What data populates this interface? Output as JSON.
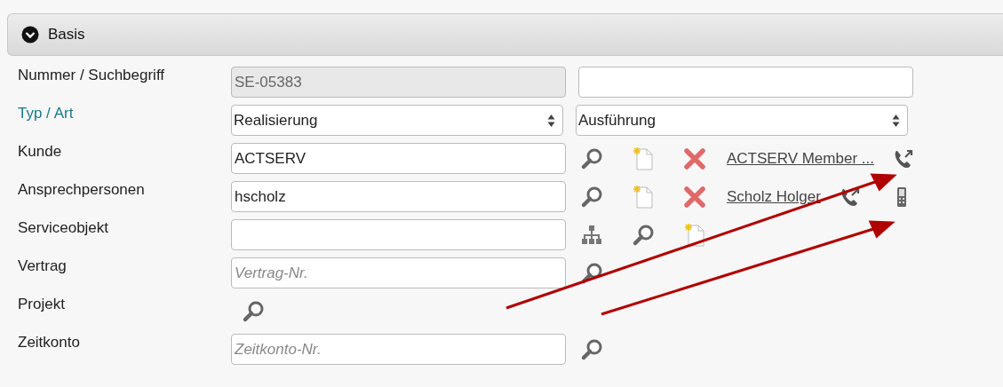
{
  "panel": {
    "title": "Basis",
    "expanded": true
  },
  "rows": [
    {
      "label": "Nummer / Suchbegriff",
      "label_link": false,
      "controls": [
        {
          "kind": "text",
          "value": "SE-05383",
          "disabled": true
        },
        {
          "kind": "text",
          "disabled": false
        }
      ]
    },
    {
      "label": "Typ / Art",
      "label_link": true,
      "controls": [
        {
          "kind": "select",
          "value": "Realisierung"
        },
        {
          "kind": "select",
          "value": "Ausführung"
        }
      ]
    },
    {
      "label": "Kunde",
      "label_link": false,
      "controls": [
        {
          "kind": "text",
          "value": "ACTSERV",
          "disabled": false
        },
        {
          "kind": "search"
        },
        {
          "kind": "new"
        },
        {
          "kind": "delete"
        },
        {
          "kind": "link",
          "text": "ACTSERV Member ..."
        },
        {
          "kind": "phone"
        }
      ]
    },
    {
      "label": "Ansprechpersonen",
      "label_link": false,
      "controls": [
        {
          "kind": "text",
          "value": "hscholz",
          "disabled": false
        },
        {
          "kind": "search"
        },
        {
          "kind": "new"
        },
        {
          "kind": "delete"
        },
        {
          "kind": "link",
          "text": "Scholz Holger"
        },
        {
          "kind": "phone"
        },
        {
          "kind": "mobile"
        }
      ]
    },
    {
      "label": "Serviceobjekt",
      "label_link": false,
      "controls": [
        {
          "kind": "text",
          "disabled": false
        },
        {
          "kind": "tree"
        },
        {
          "kind": "search"
        },
        {
          "kind": "new"
        }
      ]
    },
    {
      "label": "Vertrag",
      "label_link": false,
      "controls": [
        {
          "kind": "text",
          "placeholder": "Vertrag-Nr.",
          "disabled": false
        },
        {
          "kind": "search"
        }
      ]
    },
    {
      "label": "Projekt",
      "label_link": false,
      "controls": [
        {
          "kind": "search"
        }
      ]
    },
    {
      "label": "Zeitkonto",
      "label_link": false,
      "controls": [
        {
          "kind": "text",
          "placeholder": "Zeitkonto-Nr.",
          "disabled": false
        },
        {
          "kind": "search"
        }
      ]
    }
  ]
}
